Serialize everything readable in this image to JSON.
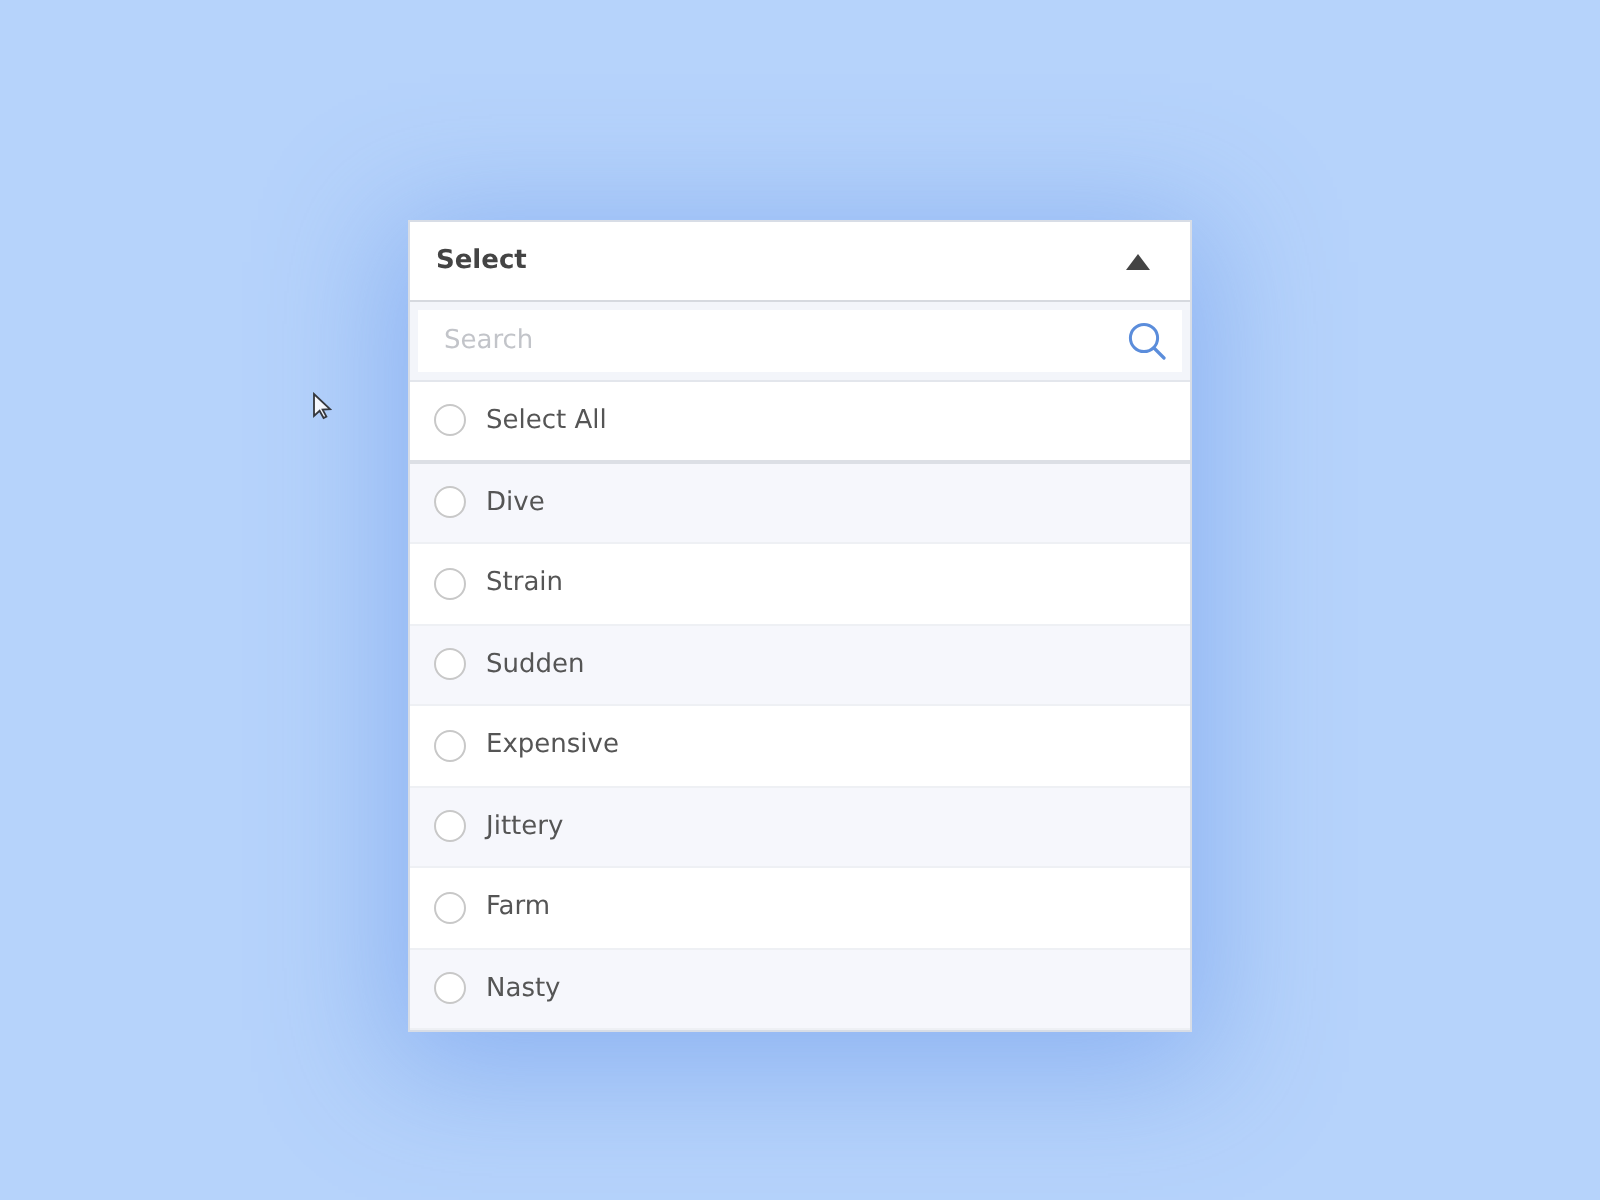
{
  "dropdown": {
    "label": "Select",
    "expanded": true,
    "search": {
      "placeholder": "Search"
    },
    "select_all": {
      "label": "Select All",
      "checked": false
    },
    "options": [
      {
        "label": "Dive",
        "checked": false
      },
      {
        "label": "Strain",
        "checked": false
      },
      {
        "label": "Sudden",
        "checked": false
      },
      {
        "label": "Expensive",
        "checked": false
      },
      {
        "label": "Jittery",
        "checked": false
      },
      {
        "label": "Farm",
        "checked": false
      },
      {
        "label": "Nasty",
        "checked": false
      }
    ]
  }
}
